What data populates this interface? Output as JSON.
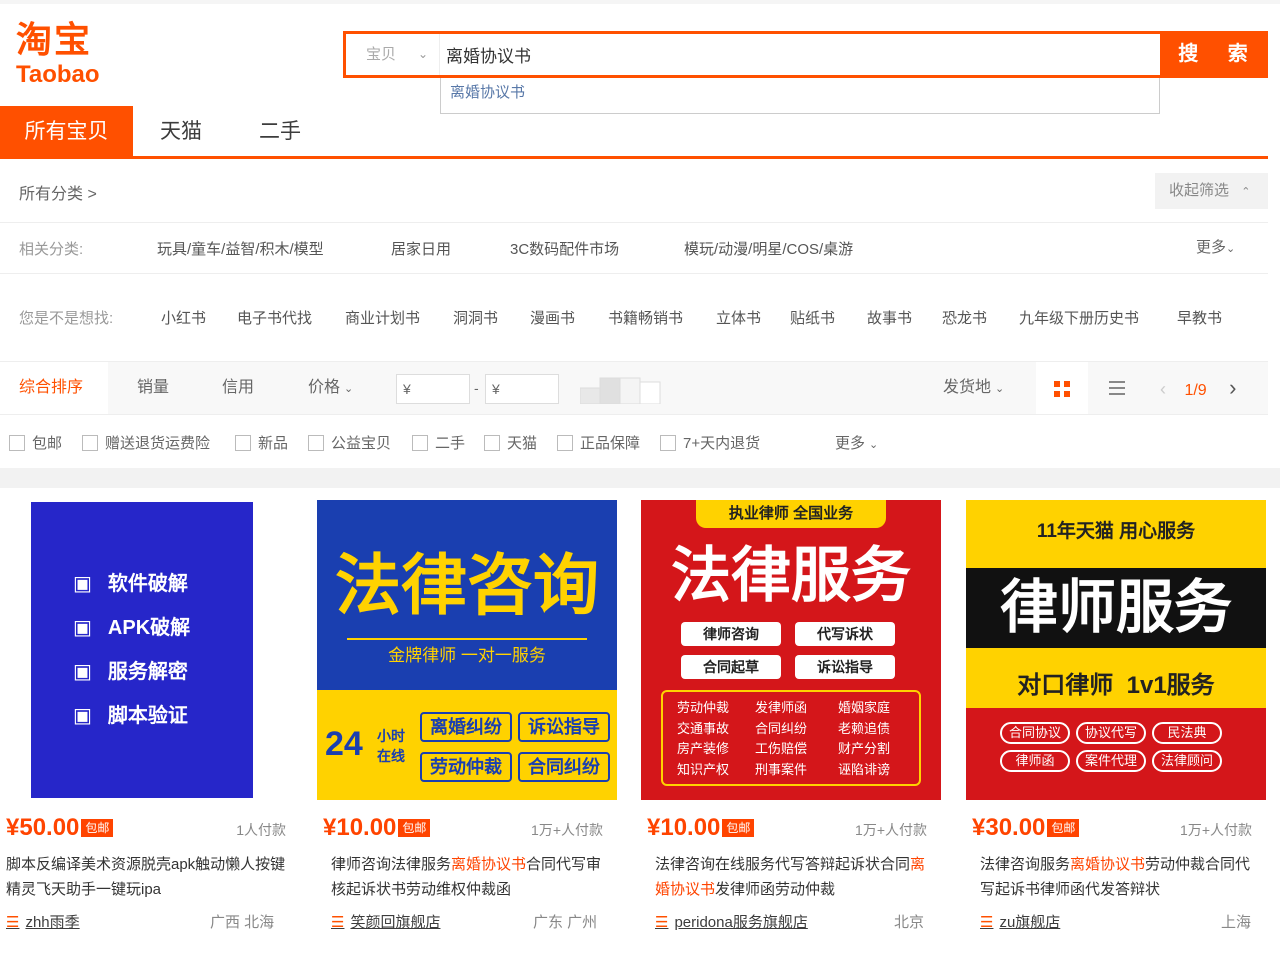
{
  "logo": {
    "cn": "淘宝",
    "en": "Taobao"
  },
  "search": {
    "category": "宝贝",
    "query": "离婚协议书",
    "button": "搜 索",
    "suggestion": "离婚协议书"
  },
  "tabs": [
    {
      "label": "所有宝贝"
    },
    {
      "label": "天猫"
    },
    {
      "label": "二手"
    }
  ],
  "filters": {
    "crumb": "所有分类 >",
    "collapse": "收起筛选",
    "related_label": "相关分类:",
    "related": [
      "玩具/童车/益智/积木/模型",
      "居家日用",
      "3C数码配件市场",
      "模玩/动漫/明星/COS/桌游"
    ],
    "more": "更多",
    "didyoumean_label": "您是不是想找:",
    "didyoumean": [
      "小红书",
      "电子书代找",
      "商业计划书",
      "洞洞书",
      "漫画书",
      "书籍畅销书",
      "立体书",
      "贴纸书",
      "故事书",
      "恐龙书",
      "九年级下册历史书",
      "早教书"
    ]
  },
  "sort": {
    "items": [
      "综合排序",
      "销量",
      "信用",
      "价格"
    ],
    "price_from": "¥",
    "price_to": "¥",
    "dash": "-",
    "ship_from": "发货地",
    "page": "1/9"
  },
  "checks": [
    "包邮",
    "赠送退货运费险",
    "新品",
    "公益宝贝",
    "二手",
    "天猫",
    "正品保障",
    "7+天内退货"
  ],
  "checks_more": "更多",
  "products": [
    {
      "price": "¥50.00",
      "badge": "包邮",
      "paid": "1人付款",
      "title_a": "脚本反编译美术资源脱壳apk触动懒人按键精灵飞天助手一键玩ipa",
      "title_hl": "",
      "title_b": "",
      "shop": "zhh雨季",
      "location": "广西 北海",
      "img_lines": [
        "软件破解",
        "APK破解",
        "服务解密",
        "脚本验证"
      ]
    },
    {
      "price": "¥10.00",
      "badge": "包邮",
      "paid": "1万+人付款",
      "title_a": "律师咨询法律服务",
      "title_hl": "离婚协议书",
      "title_b": "合同代写审核起诉状书劳动维权仲裁函",
      "shop": "笑颜回旗舰店",
      "location": "广东 广州",
      "img_title": "法律咨询",
      "img_sub": "金牌律师 一对一服务",
      "img_hours": "24",
      "img_hours_top": "小时",
      "img_hours_bottom": "在线",
      "img_tags": [
        "离婚纠纷",
        "诉讼指导",
        "劳动仲裁",
        "合同纠纷"
      ]
    },
    {
      "price": "¥10.00",
      "badge": "包邮",
      "paid": "1万+人付款",
      "title_a": "法律咨询在线服务代写答辩起诉状合同",
      "title_hl": "离婚协议书",
      "title_b": "发律师函劳动仲裁",
      "shop": "peridona服务旗舰店",
      "location": "北京",
      "img_top": "执业律师 全国业务",
      "img_title": "法律服务",
      "img_btns": [
        "律师咨询",
        "代写诉状",
        "合同起草",
        "诉讼指导"
      ],
      "img_grid": [
        "劳动仲裁",
        "发律师函",
        "婚姻家庭",
        "交通事故",
        "合同纠纷",
        "老赖追债",
        "房产装修",
        "工伤赔偿",
        "财产分割",
        "知识产权",
        "刑事案件",
        "诬陷诽谤"
      ]
    },
    {
      "price": "¥30.00",
      "badge": "包邮",
      "paid": "1万+人付款",
      "title_a": "法律咨询服务",
      "title_hl": "离婚协议书",
      "title_b": "劳动仲裁合同代写起诉书律师函代发答辩状",
      "shop": "zu旗舰店",
      "location": "上海",
      "img_top": "11年天猫 用心服务",
      "img_title": "律师服务",
      "img_mid": "对口律师  1v1服务",
      "img_pills": [
        "合同协议",
        "协议代写",
        "民法典",
        "律师函",
        "案件代理",
        "法律顾问"
      ]
    }
  ],
  "colors": {
    "accent": "#ff5000",
    "price": "#ff4400",
    "link_blue": "#5878a8"
  }
}
